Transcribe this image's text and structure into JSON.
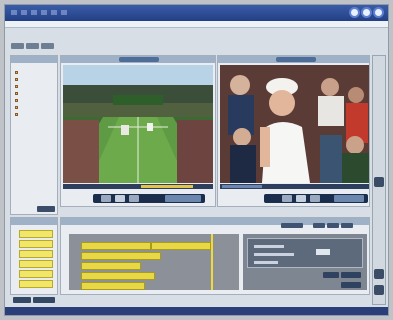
{
  "window": {
    "title": "",
    "accent": "#233f84"
  },
  "toolbar": {
    "tabs": [
      "",
      "",
      ""
    ]
  },
  "left_panel": {
    "header": "",
    "items": [
      "",
      "",
      "",
      "",
      "",
      "",
      ""
    ],
    "bottom_button": ""
  },
  "source_viewer": {
    "header": "",
    "pill": ""
  },
  "edit_viewer": {
    "header": "",
    "pill": ""
  },
  "transport": {
    "left_button": "",
    "right_button": ""
  },
  "effects_panel": {
    "header": "",
    "buttons": [
      "",
      "",
      "",
      "",
      "",
      ""
    ]
  },
  "timeline": {
    "header": "",
    "segments": [
      "",
      "",
      "",
      "",
      "",
      ""
    ],
    "zoom_label": ""
  },
  "properties": {
    "buttons": [
      "",
      "",
      ""
    ]
  },
  "bottom_buttons": [
    "",
    ""
  ],
  "colors": {
    "clip_yellow": "#e8d848",
    "panel_bg": "#e9edf1",
    "header_blue": "#9fb1c7"
  }
}
